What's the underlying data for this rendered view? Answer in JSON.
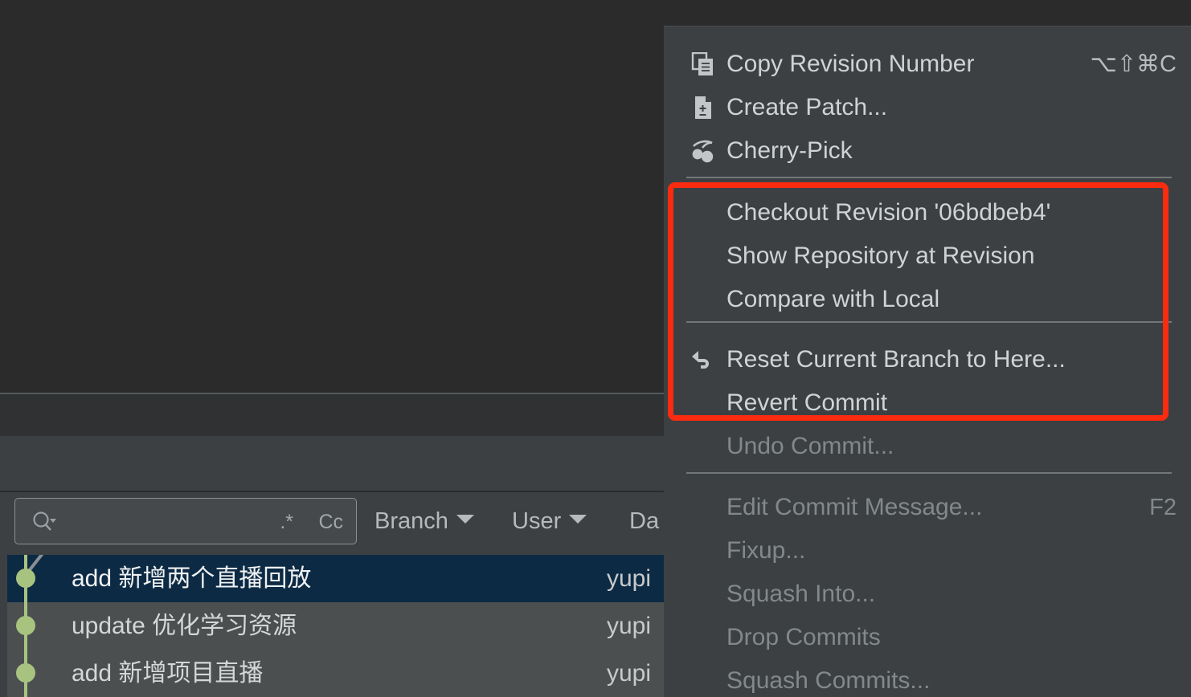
{
  "app": {
    "theme_bg": "#2b2b2b",
    "panel_bg": "#3c4043",
    "accent_highlight": "#fb2b10",
    "selection_bg": "#0d2a44",
    "graph_node_color": "#a8c380"
  },
  "log_toolbar": {
    "search": {
      "value": "",
      "placeholder": "",
      "icon": "search-icon",
      "regex_toggle": ".*",
      "case_toggle": "Cc"
    },
    "filters": [
      {
        "label": "Branch",
        "icon": "chevron-down-icon"
      },
      {
        "label": "User",
        "icon": "chevron-down-icon"
      },
      {
        "label": "Da",
        "icon": "chevron-down-icon"
      }
    ]
  },
  "commits": [
    {
      "subject": "add 新增两个直播回放",
      "author": "yupi",
      "selected": true
    },
    {
      "subject": "update 优化学习资源",
      "author": "yupi",
      "selected": false
    },
    {
      "subject": "add 新增项目直播",
      "author": "yupi",
      "selected": false
    }
  ],
  "context_menu": {
    "items": [
      {
        "label": "Copy Revision Number",
        "shortcut": "⌥⇧⌘C",
        "icon": "copy-icon",
        "enabled": true
      },
      {
        "label": "Create Patch...",
        "shortcut": "",
        "icon": "patch-icon",
        "enabled": true
      },
      {
        "label": "Cherry-Pick",
        "shortcut": "",
        "icon": "cherry-icon",
        "enabled": true
      },
      {
        "label": "Checkout Revision '06bdbeb4'",
        "shortcut": "",
        "icon": "",
        "enabled": true
      },
      {
        "label": "Show Repository at Revision",
        "shortcut": "",
        "icon": "",
        "enabled": true
      },
      {
        "label": "Compare with Local",
        "shortcut": "",
        "icon": "",
        "enabled": true
      },
      {
        "label": "Reset Current Branch to Here...",
        "shortcut": "",
        "icon": "undo-icon",
        "enabled": true
      },
      {
        "label": "Revert Commit",
        "shortcut": "",
        "icon": "",
        "enabled": true
      },
      {
        "label": "Undo Commit...",
        "shortcut": "",
        "icon": "",
        "enabled": false
      },
      {
        "label": "Edit Commit Message...",
        "shortcut": "F2",
        "icon": "",
        "enabled": false
      },
      {
        "label": "Fixup...",
        "shortcut": "",
        "icon": "",
        "enabled": false
      },
      {
        "label": "Squash Into...",
        "shortcut": "",
        "icon": "",
        "enabled": false
      },
      {
        "label": "Drop Commits",
        "shortcut": "",
        "icon": "",
        "enabled": false
      },
      {
        "label": "Squash Commits...",
        "shortcut": "",
        "icon": "",
        "enabled": false
      }
    ]
  }
}
